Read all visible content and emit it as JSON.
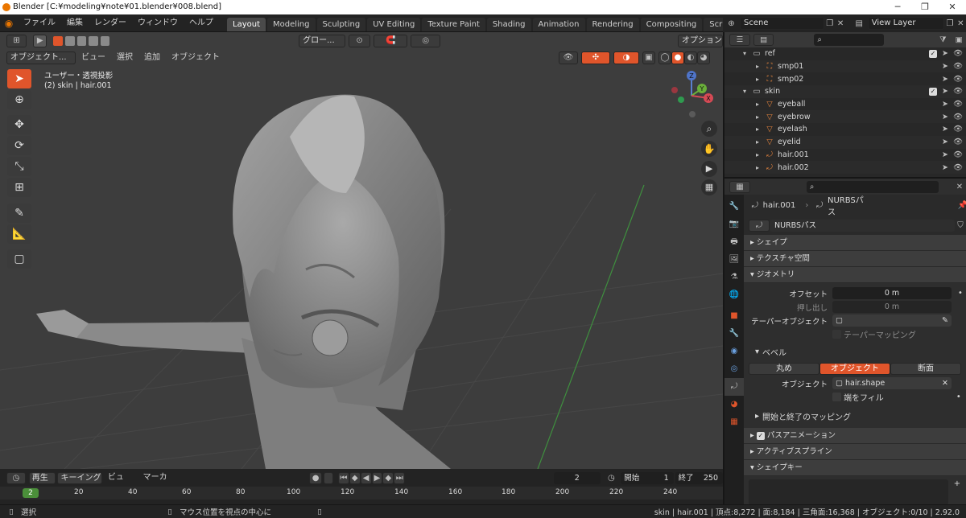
{
  "title": "Blender [C:¥modeling¥note¥01.blender¥008.blend]",
  "menu": [
    "ファイル",
    "編集",
    "レンダー",
    "ウィンドウ",
    "ヘルプ"
  ],
  "workspaces": [
    "Layout",
    "Modeling",
    "Sculpting",
    "UV Editing",
    "Texture Paint",
    "Shading",
    "Animation",
    "Rendering",
    "Compositing",
    "Scripting"
  ],
  "active_workspace": "Layout",
  "scene": "Scene",
  "view_layer": "View Layer",
  "viewport": {
    "orientation": "グロー...",
    "options": "オプション",
    "mode": "オブジェクト...",
    "menus": [
      "ビュー",
      "選択",
      "追加",
      "オブジェクト"
    ],
    "view_name": "ユーザー・透視投影",
    "collection_info": "(2) skin | hair.001",
    "gizmo_axes": [
      "Z",
      "Y",
      "X"
    ]
  },
  "outliner": {
    "rows": [
      {
        "name": "ref",
        "type": "collection",
        "indent": 1
      },
      {
        "name": "smp01",
        "type": "empty",
        "indent": 2
      },
      {
        "name": "smp02",
        "type": "empty",
        "indent": 2
      },
      {
        "name": "skin",
        "type": "collection",
        "indent": 1
      },
      {
        "name": "eyeball",
        "type": "mesh",
        "indent": 2
      },
      {
        "name": "eyebrow",
        "type": "mesh",
        "indent": 2
      },
      {
        "name": "eyelash",
        "type": "mesh",
        "indent": 2
      },
      {
        "name": "eyelid",
        "type": "mesh",
        "indent": 2
      },
      {
        "name": "hair.001",
        "type": "curve",
        "indent": 2
      },
      {
        "name": "hair.002",
        "type": "curve",
        "indent": 2
      }
    ]
  },
  "props": {
    "breadcrumb_object": "hair.001",
    "breadcrumb_data": "NURBSパス",
    "datablock": "NURBSパス",
    "panels": {
      "shape": "シェイプ",
      "texture_space": "テクスチャ空間",
      "geometry": "ジオメトリ",
      "bevel": "ベベル",
      "start_end": "開始と終了のマッピング",
      "path_anim": "パスアニメーション",
      "active_spline": "アクティブスプライン",
      "shape_keys": "シェイプキー"
    },
    "offset_label": "オフセット",
    "offset_value": "0 m",
    "extrude_label": "押し出し",
    "extrude_value": "0 m",
    "taper_label": "テーパーオブジェクト",
    "taper_map": "テーパーマッピング",
    "bevel_modes": [
      "丸め",
      "オブジェクト",
      "断面"
    ],
    "bevel_active": "オブジェクト",
    "object_label": "オブジェクト",
    "object_value": "hair.shape",
    "fill_caps": "端をフィル"
  },
  "timeline": {
    "menus": [
      "再生",
      "キーイング",
      "ビュー",
      "マーカー"
    ],
    "current_frame": "2",
    "start_label": "開始",
    "start": "1",
    "end_label": "終了",
    "end": "250",
    "ticks": [
      "20",
      "40",
      "60",
      "80",
      "100",
      "120",
      "140",
      "160",
      "180",
      "200",
      "220",
      "240"
    ],
    "playhead_label": "2"
  },
  "status": {
    "left": "選択",
    "middle": "マウス位置を視点の中心に",
    "right": "skin | hair.001 | 頂点:8,272 | 面:8,184 | 三角面:16,368 | オブジェクト:0/10 | 2.92.0"
  },
  "colors": {
    "accent": "#e0552b",
    "selected": "#e0552b",
    "bg": "#3d3d3d"
  }
}
